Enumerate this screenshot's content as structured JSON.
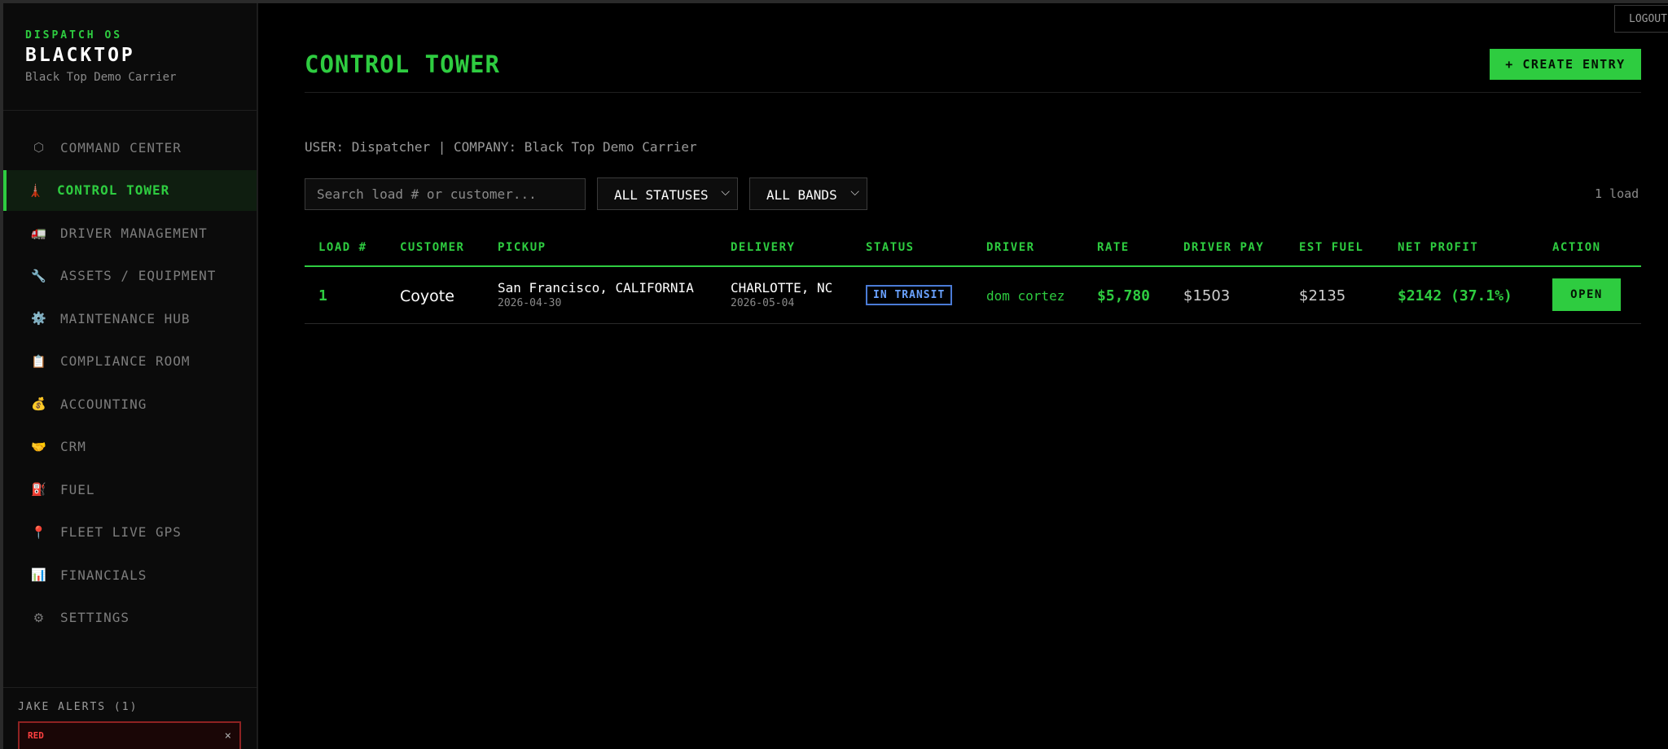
{
  "brand": {
    "kicker": "DISPATCH OS",
    "name": "BLACKTOP",
    "company": "Black Top Demo Carrier"
  },
  "nav": [
    {
      "icon": "⬡",
      "icon_name": "hexagon-icon",
      "label": "COMMAND CENTER",
      "active": false
    },
    {
      "icon": "🗼",
      "icon_name": "tower-icon",
      "label": "CONTROL TOWER",
      "active": true
    },
    {
      "icon": "🚛",
      "icon_name": "truck-icon",
      "label": "DRIVER MANAGEMENT",
      "active": false
    },
    {
      "icon": "🔧",
      "icon_name": "wrench-icon",
      "label": "ASSETS / EQUIPMENT",
      "active": false
    },
    {
      "icon": "⚙️",
      "icon_name": "gear-icon",
      "label": "MAINTENANCE HUB",
      "active": false
    },
    {
      "icon": "📋",
      "icon_name": "clipboard-icon",
      "label": "COMPLIANCE ROOM",
      "active": false
    },
    {
      "icon": "💰",
      "icon_name": "money-bag-icon",
      "label": "ACCOUNTING",
      "active": false
    },
    {
      "icon": "🤝",
      "icon_name": "handshake-icon",
      "label": "CRM",
      "active": false
    },
    {
      "icon": "⛽",
      "icon_name": "fuel-pump-icon",
      "label": "FUEL",
      "active": false
    },
    {
      "icon": "📍",
      "icon_name": "map-pin-icon",
      "label": "FLEET LIVE GPS",
      "active": false
    },
    {
      "icon": "📊",
      "icon_name": "bar-chart-icon",
      "label": "FINANCIALS",
      "active": false
    },
    {
      "icon": "⚙",
      "icon_name": "settings-icon",
      "label": "SETTINGS",
      "active": false
    }
  ],
  "alerts": {
    "title": "JAKE ALERTS (1)",
    "items": [
      {
        "level": "RED",
        "close": "×"
      }
    ]
  },
  "header": {
    "logout": "LOGOUT",
    "title": "CONTROL TOWER",
    "create_label": "+ CREATE ENTRY"
  },
  "context": "USER: Dispatcher | COMPANY: Black Top Demo Carrier",
  "filters": {
    "search_placeholder": "Search load # or customer...",
    "status_selected": "ALL STATUSES",
    "bands_selected": "ALL BANDS",
    "chevron": "⌵",
    "count": "1 load"
  },
  "table": {
    "headers": [
      "LOAD #",
      "CUSTOMER",
      "PICKUP",
      "DELIVERY",
      "STATUS",
      "DRIVER",
      "RATE",
      "DRIVER PAY",
      "EST FUEL",
      "NET PROFIT",
      "ACTION"
    ],
    "rows": [
      {
        "load": "1",
        "customer": "Coyote",
        "pickup_city": "San Francisco, CALIFORNIA",
        "pickup_date": "2026-04-30",
        "delivery_city": "CHARLOTTE, NC",
        "delivery_date": "2026-05-04",
        "status": "IN TRANSIT",
        "driver": "dom cortez",
        "rate": "$5,780",
        "driver_pay": "$1503",
        "est_fuel": "$2135",
        "net_profit": "$2142 (37.1%)",
        "action": "OPEN"
      }
    ]
  },
  "colors": {
    "accent": "#2ecc40",
    "status_transit": "#6aa2ff",
    "alert_red": "#ff4040",
    "background": "#000000"
  }
}
